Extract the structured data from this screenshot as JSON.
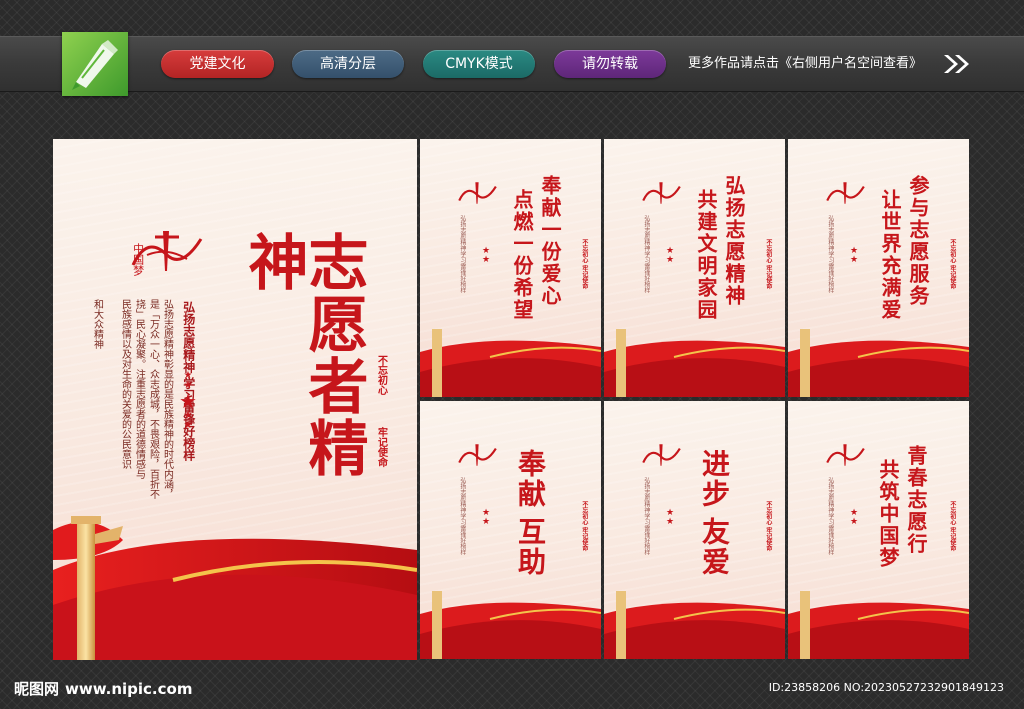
{
  "header": {
    "tags": [
      "党建文化",
      "高清分层",
      "CMYK模式",
      "请勿转载"
    ],
    "more_text": "更多作品请点击《右侧用户名空间查看》",
    "colors": {
      "tag1": "#c42e2e",
      "tag2": "#3f5d79",
      "tag3": "#237b75",
      "tag4": "#6c2f89"
    }
  },
  "posters": {
    "main": {
      "title": "志愿者精神",
      "subtitle": "弘扬志愿精神 学习雷锋好榜样",
      "body": [
        "弘扬志愿精神彰显的是民族精神的时代内涵，",
        "是「万众一心、众志成城，不畏艰险，百折不",
        "挠」民心凝聚。注重志愿者的道德情感与",
        "民族感情以及对生命的关爱的公民意识",
        "和大众精神"
      ],
      "seal_left": "不忘初心",
      "seal_right": "牢记使命",
      "logo_text": "中国梦"
    },
    "small": [
      {
        "title": [
          "奉献一份爱心",
          "点燃一份希望"
        ]
      },
      {
        "title": [
          "弘扬志愿精神",
          "共建文明家园"
        ]
      },
      {
        "title": [
          "参与志愿服务",
          "让世界充满爱"
        ]
      },
      {
        "title": [
          "奉献",
          "互助"
        ]
      },
      {
        "title": [
          "进步",
          "友爱"
        ]
      },
      {
        "title": [
          "青春志愿行",
          "共筑中国梦"
        ]
      }
    ]
  },
  "footer": {
    "site_name": "昵图网",
    "site_url": "www.nipic.com",
    "id_text": "ID:23858206 NO:20230527232901849123"
  },
  "accent_color": "#c6161b"
}
